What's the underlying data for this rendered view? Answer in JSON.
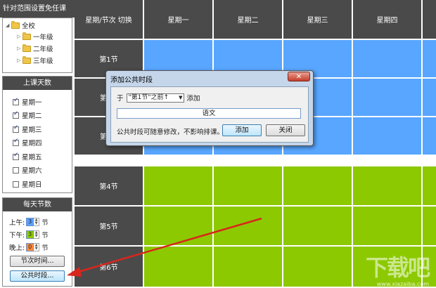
{
  "left": {
    "header": "针对范围设置免任课",
    "tree": [
      {
        "label": "全校",
        "level": 0,
        "expander": "◢"
      },
      {
        "label": "一年级",
        "level": 1,
        "expander": "▷"
      },
      {
        "label": "二年级",
        "level": 1,
        "expander": "▷"
      },
      {
        "label": "三年级",
        "level": 1,
        "expander": "▷"
      }
    ],
    "days_header": "上课天数",
    "days": [
      {
        "label": "星期一",
        "checked": true
      },
      {
        "label": "星期二",
        "checked": true
      },
      {
        "label": "星期三",
        "checked": true
      },
      {
        "label": "星期四",
        "checked": true
      },
      {
        "label": "星期五",
        "checked": true
      },
      {
        "label": "星期六",
        "checked": false
      },
      {
        "label": "星期日",
        "checked": false
      }
    ],
    "periods_header": "每天节数",
    "periods": [
      {
        "label": "上午:",
        "value": "3",
        "unit": "节",
        "color": "#5aa0ff"
      },
      {
        "label": "下午:",
        "value": "3",
        "unit": "节",
        "color": "#8cc900"
      },
      {
        "label": "晚上:",
        "value": "0",
        "unit": "节",
        "color": "#ff8c3a"
      }
    ],
    "btn_period_time": "节次时间...",
    "btn_public_time": "公共时段..."
  },
  "grid": {
    "corner": "星期/节次 切换",
    "days": [
      "星期一",
      "星期二",
      "星期三",
      "星期四"
    ],
    "rows": [
      "第1节",
      "第",
      "第",
      "第4节",
      "第5节",
      "第6节"
    ],
    "colors": {
      "morning": "#58a6ff",
      "afternoon": "#8cc900",
      "label": "#4a4a4a"
    }
  },
  "dialog": {
    "title": "添加公共时段",
    "close": "✕",
    "prefix": "于",
    "select_value": "\"第1节\"之前↑",
    "suffix": "添加",
    "input_value": "语文",
    "note": "公共时段可随意修改，不影响排课。",
    "add_button": "添加",
    "close_button": "关闭"
  },
  "watermark": {
    "text": "下载吧",
    "sub": "www.xiazaiba.com"
  }
}
